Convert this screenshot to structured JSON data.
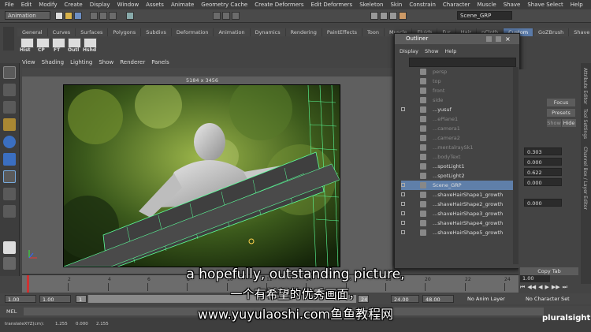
{
  "menubar": [
    "File",
    "Edit",
    "Modify",
    "Create",
    "Display",
    "Window",
    "Assets",
    "Animate",
    "Geometry Cache",
    "Create Deformers",
    "Edit Deformers",
    "Skeleton",
    "Skin",
    "Constrain",
    "Character",
    "Muscle",
    "Shave",
    "Shave Select",
    "Help"
  ],
  "statusline": {
    "mode": "Animation",
    "scene_field": "Scene_GRP"
  },
  "shelf": {
    "tabs": [
      "General",
      "Curves",
      "Surfaces",
      "Polygons",
      "Subdivs",
      "Deformation",
      "Animation",
      "Dynamics",
      "Rendering",
      "PaintEffects",
      "Toon",
      "Muscle",
      "Fluids",
      "Fur",
      "Hair",
      "nCloth",
      "Custom",
      "GoZBrush",
      "Shave"
    ],
    "active_tab": "Custom",
    "icons": [
      "Hist",
      "CP",
      "FT",
      "Outl",
      "Hshd"
    ]
  },
  "panel_menu": [
    "View",
    "Shading",
    "Lighting",
    "Show",
    "Renderer",
    "Panels"
  ],
  "viewport": {
    "resolution": "5184 x 3456"
  },
  "outliner": {
    "title": "Outliner",
    "menu": [
      "Display",
      "Show",
      "Help"
    ],
    "items": [
      {
        "label": "persp",
        "dim": true,
        "expand": false
      },
      {
        "label": "top",
        "dim": true,
        "expand": false
      },
      {
        "label": "front",
        "dim": true,
        "expand": false
      },
      {
        "label": "side",
        "dim": true,
        "expand": false
      },
      {
        "label": "...yusuf",
        "dim": false,
        "expand": true
      },
      {
        "label": "...ePlane1",
        "dim": true,
        "expand": false
      },
      {
        "label": "...camera1",
        "dim": true,
        "expand": false
      },
      {
        "label": "...camera2",
        "dim": true,
        "expand": false
      },
      {
        "label": "...mentalraySk1",
        "dim": true,
        "expand": false
      },
      {
        "label": "...bodyText",
        "dim": true,
        "expand": false
      },
      {
        "label": "...spotLight1",
        "dim": false,
        "expand": false
      },
      {
        "label": "...spotLight2",
        "dim": false,
        "expand": false
      },
      {
        "label": "Scene_GRP",
        "dim": false,
        "expand": true,
        "selected": true
      },
      {
        "label": "...shaveHairShape1_growth",
        "dim": false,
        "expand": true
      },
      {
        "label": "...shaveHairShape2_growth",
        "dim": false,
        "expand": true
      },
      {
        "label": "...shaveHairShape3_growth",
        "dim": false,
        "expand": true
      },
      {
        "label": "...shaveHairShape4_growth",
        "dim": false,
        "expand": true
      },
      {
        "label": "...shaveHairShape5_growth",
        "dim": false,
        "expand": true
      }
    ]
  },
  "attribute_editor": {
    "buttons": [
      "Focus",
      "Presets",
      "Show",
      "Hide"
    ],
    "values": [
      "0.303",
      "0.000",
      "0.622",
      "0.000",
      "0.000"
    ],
    "copy_tab": "Copy Tab"
  },
  "side_tabs": [
    "Attribute Editor",
    "Tool Settings",
    "Channel Box / Layer Editor"
  ],
  "timeslider": {
    "ticks": [
      "2",
      "4",
      "6",
      "8",
      "10",
      "12",
      "14",
      "16",
      "18",
      "20",
      "22",
      "24"
    ],
    "current_frame": "1.00"
  },
  "range": {
    "start": "1.00",
    "inner_start": "1.00",
    "current": "1",
    "end": "24",
    "inner_end": "24.00",
    "anim_end": "48.00",
    "anim_layer": "No Anim Layer",
    "character": "No Character Set"
  },
  "mel": {
    "label": "MEL"
  },
  "helpline": {
    "text": "translateXYZ(cm): ",
    "values": [
      "1.255",
      "0.000",
      "2.155"
    ]
  },
  "subtitles": {
    "line1": "a hopefully, outstanding picture,",
    "line2": "一个有希望的优秀画面，",
    "line3": "www.yuyulaoshi.com鱼鱼教程网"
  },
  "watermark": "pluralsight",
  "colors": {
    "selection": "#5f7fa9",
    "accent_hair": "#5cff9a"
  }
}
